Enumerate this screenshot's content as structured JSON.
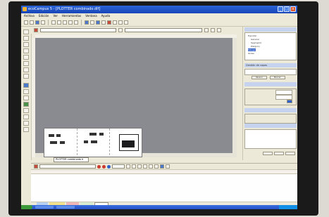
{
  "window": {
    "title": "ecoCampus 5 - [PLOTTER combinado.dlf]",
    "buttons": {
      "minimize": "_",
      "maximize": "□",
      "close": "x"
    }
  },
  "menu": {
    "items": [
      "Archivo",
      "Edición",
      "Ver",
      "Herramientas",
      "Ventana",
      "Ayuda"
    ]
  },
  "document": {
    "sheet_tab": "PLOTTER combinado ▾"
  },
  "right_panel": {
    "tree_items": [
      "Ejecutar",
      "Generar",
      "Segmento",
      "Polígono",
      "Dibujar",
      "Orden"
    ],
    "section_title": "Gestión de capas",
    "button_labels": [
      "Nuevo",
      "Borrar"
    ]
  },
  "colors": {
    "title_bar": "#1e50c8",
    "canvas": "#8a8b90",
    "selection": "#2f5fc9"
  }
}
